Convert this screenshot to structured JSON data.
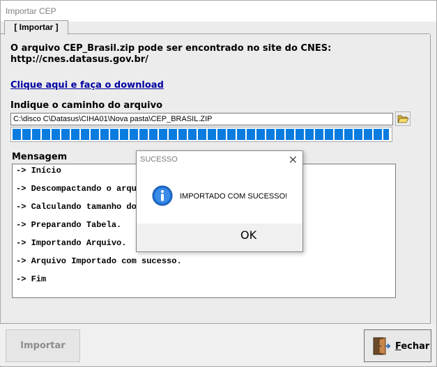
{
  "window": {
    "title": "Importar CEP"
  },
  "tab": {
    "label": "[ Importar ]"
  },
  "info": {
    "line1": "O arquivo CEP_Brasil.zip pode ser encontrado no site do CNES:",
    "line2": "http://cnes.datasus.gov.br/"
  },
  "download_link": "Clique aqui e faça o download",
  "path": {
    "label": "Indique o caminho do arquivo",
    "value": "C:\\disco C\\Datasus\\CIHA01\\Nova pasta\\CEP_BRASIL.ZIP"
  },
  "progress": {
    "fraction": 1.0
  },
  "messages": {
    "label": "Mensagem",
    "lines": [
      "-> Início",
      "-> Descompactando o arquivo",
      "-> Calculando tamanho do arquivo",
      "-> Preparando Tabela.",
      "-> Importando Arquivo.",
      "-> Arquivo Importado com sucesso.",
      "-> Fim"
    ]
  },
  "buttons": {
    "import_label": "Importar",
    "close_label_first": "F",
    "close_label_rest": "echar"
  },
  "dialog": {
    "title": "SUCESSO",
    "message": "IMPORTADO COM SUCESSO!",
    "ok_label": "OK",
    "icon": "info-icon"
  },
  "colors": {
    "progress": "#0a7ce0",
    "link": "#0000a0",
    "dialog_border": "#0078d7"
  }
}
